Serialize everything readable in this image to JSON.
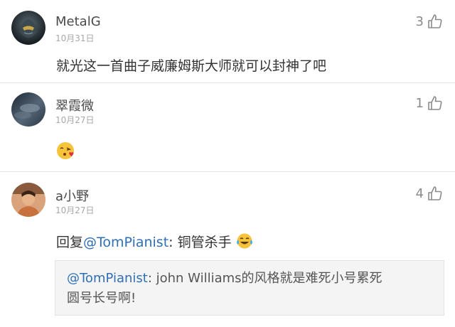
{
  "colors": {
    "mention": "#2f6fb4",
    "text": "#333333",
    "meta": "#a8a8a8",
    "quote_bg": "#f4f4f4"
  },
  "comments": [
    {
      "username": "MetalG",
      "date": "10月31日",
      "likes": "3",
      "text": "就光这一首曲子威廉姆斯大师就可以封神了吧",
      "avatar_icon": "helmet-avatar-icon"
    },
    {
      "username": "翠霞微",
      "date": "10月27日",
      "likes": "1",
      "emoji": "kissing-heart-emoji-icon",
      "avatar_icon": "sky-avatar-icon"
    },
    {
      "username": "a小野",
      "date": "10月27日",
      "likes": "4",
      "reply_prefix": "回复",
      "mention": "@TomPianist",
      "reply_text": ": 铜管杀手",
      "emoji": "tears-of-joy-emoji-icon",
      "avatar_icon": "person-avatar-icon",
      "quote": {
        "mention": "@TomPianist",
        "line1": ": john Williams的风格就是难死小号累死",
        "line2": "圆号长号啊!"
      }
    }
  ]
}
